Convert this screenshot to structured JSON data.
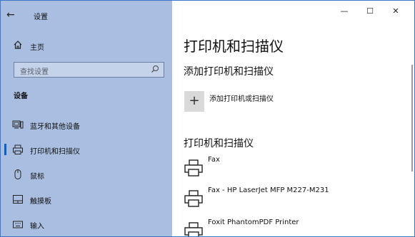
{
  "window": {
    "title": "设置",
    "controls": {
      "minimize": "—",
      "maximize": "☐",
      "close": "✕"
    }
  },
  "sidebar": {
    "back_glyph": "←",
    "home_label": "主页",
    "search_placeholder": "查找设置",
    "section_label": "设备",
    "items": [
      {
        "label": "蓝牙和其他设备",
        "icon": "bluetooth-devices-icon",
        "active": false
      },
      {
        "label": "打印机和扫描仪",
        "icon": "printer-icon",
        "active": true
      },
      {
        "label": "鼠标",
        "icon": "mouse-icon",
        "active": false
      },
      {
        "label": "触摸板",
        "icon": "touchpad-icon",
        "active": false
      },
      {
        "label": "输入",
        "icon": "keyboard-icon",
        "active": false
      }
    ]
  },
  "main": {
    "page_title": "打印机和扫描仪",
    "add_heading": "添加打印机和扫描仪",
    "add_button_label": "添加打印机或扫描仪",
    "list_heading": "打印机和扫描仪",
    "printers": [
      {
        "name": "Fax"
      },
      {
        "name": "Fax - HP LaserJet MFP M227-M231"
      },
      {
        "name": "Foxit PhantomPDF Printer"
      }
    ]
  },
  "colors": {
    "sidebar_bg": "#a9bee0",
    "accent": "#0a5fc8",
    "content_bg": "#ffffff"
  }
}
